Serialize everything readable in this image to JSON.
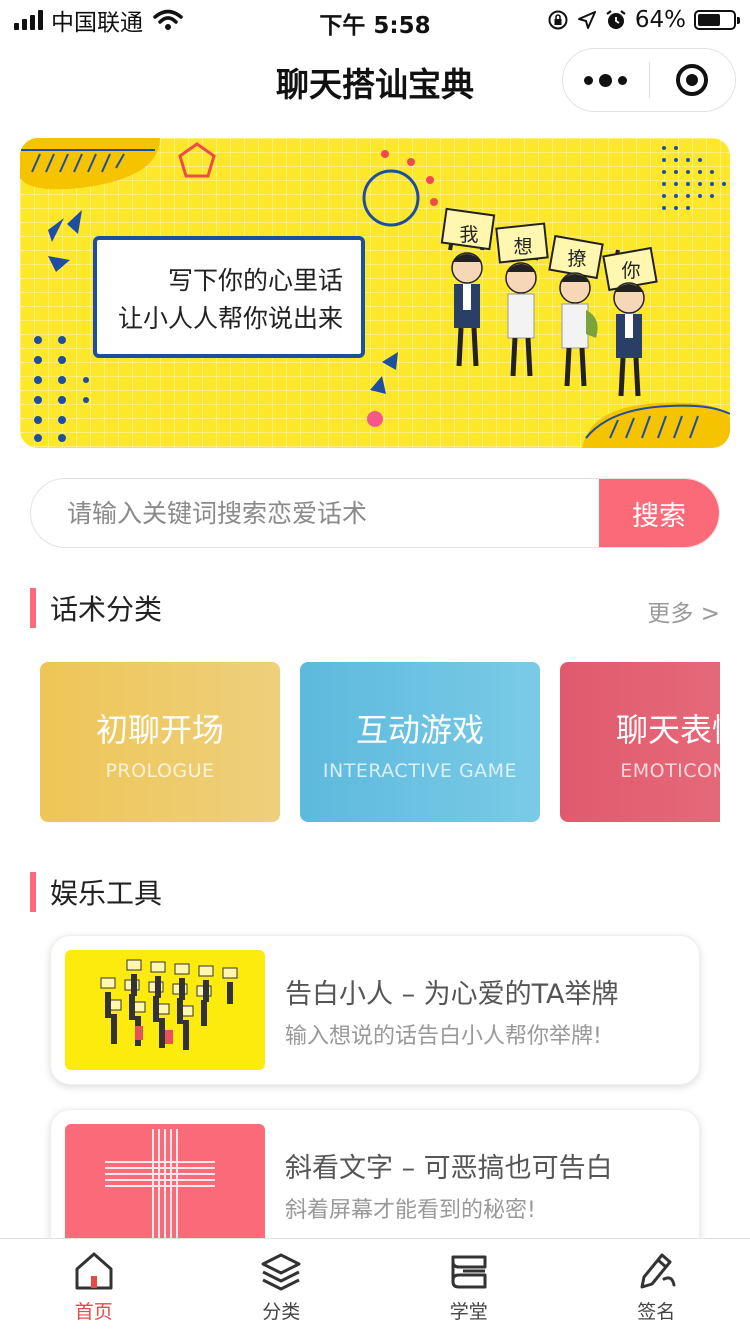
{
  "status_bar": {
    "carrier": "中国联通",
    "time": "下午 5:58",
    "battery_percent": "64%",
    "battery_level": 0.64,
    "icons": [
      "signal-icon",
      "wifi-icon",
      "orientation-lock-icon",
      "location-icon",
      "alarm-icon",
      "battery-icon"
    ]
  },
  "nav": {
    "title": "聊天搭讪宝典",
    "capsule_icons": [
      "more-icon",
      "close-target-icon"
    ]
  },
  "banner": {
    "line1": "写下你的心里话",
    "line2": "让小人人帮你说出来",
    "sign_chars": [
      "我",
      "想",
      "撩",
      "你"
    ],
    "bg_color": "#fde72b"
  },
  "search": {
    "placeholder": "请输入关键词搜索恋爱话术",
    "button_label": "搜索"
  },
  "section_categories": {
    "title": "话术分类",
    "more": "更多 >"
  },
  "categories": [
    {
      "title": "初聊开场",
      "subtitle": "PROLOGUE",
      "color_from": "#eec556",
      "color_to": "#eed07c"
    },
    {
      "title": "互动游戏",
      "subtitle": "INTERACTIVE GAME",
      "color_from": "#5db9dd",
      "color_to": "#7acbe6"
    },
    {
      "title": "聊天表情",
      "subtitle": "EMOTICONS",
      "color_from": "#e05a6c",
      "color_to": "#e87080"
    }
  ],
  "section_tools": {
    "title": "娱乐工具"
  },
  "tools": [
    {
      "title": "告白小人 – 为心爱的TA举牌",
      "desc": "输入想说的话告白小人帮你举牌!",
      "thumb_bg": "#fdeb0e"
    },
    {
      "title": "斜看文字 – 可恶搞也可告白",
      "desc": "斜着屏幕才能看到的秘密!",
      "thumb_bg": "#fb6a78"
    }
  ],
  "tabbar": {
    "items": [
      {
        "label": "首页",
        "icon": "home-icon",
        "active": true
      },
      {
        "label": "分类",
        "icon": "layers-icon",
        "active": false
      },
      {
        "label": "学堂",
        "icon": "book-icon",
        "active": false
      },
      {
        "label": "签名",
        "icon": "pen-icon",
        "active": false
      }
    ]
  },
  "colors": {
    "accent": "#fb6a78",
    "active_tab": "#e84a4a"
  }
}
